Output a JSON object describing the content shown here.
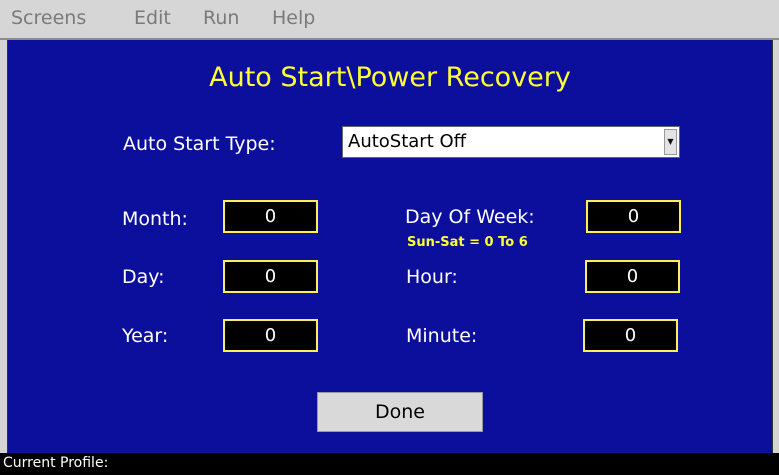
{
  "menu": {
    "items": [
      "Screens",
      "Edit",
      "Run",
      "Help"
    ]
  },
  "screen": {
    "title": "Auto Start\\Power Recovery",
    "auto_start_label": "Auto Start Type:",
    "auto_start_value": "AutoStart Off",
    "fields": {
      "month": {
        "label": "Month:",
        "value": "0"
      },
      "day": {
        "label": "Day:",
        "value": "0"
      },
      "year": {
        "label": "Year:",
        "value": "0"
      },
      "day_of_week": {
        "label": "Day Of Week:",
        "value": "0",
        "hint": "Sun-Sat = 0 To 6"
      },
      "hour": {
        "label": "Hour:",
        "value": "0"
      },
      "minute": {
        "label": "Minute:",
        "value": "0"
      }
    },
    "done_label": "Done"
  },
  "status": {
    "profile_label": "Current Profile:"
  },
  "colors": {
    "panel_bg": "#0b0f9c",
    "title": "#ffff33",
    "field_border": "#ffee55"
  }
}
